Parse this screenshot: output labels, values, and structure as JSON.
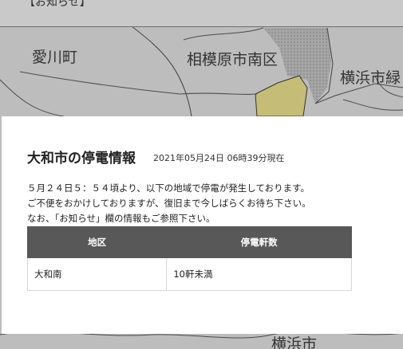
{
  "notice_bar": {
    "label": "【お知らせ】"
  },
  "map": {
    "labels": {
      "aikawa": "愛川町",
      "sagamihara": "相模原市南区",
      "yokohama": "横浜市緑",
      "bottom": "横浜市"
    },
    "colors": {
      "land": "#bdbdbd",
      "highlight": "#c5bd77",
      "dotted": "#9a9a9a",
      "road": "#4b4b4b"
    }
  },
  "panel": {
    "title": "大和市の停電情報",
    "timestamp": "2021年05月24日 06時39分現在",
    "messages": [
      "５月２４日５：５４頃より、以下の地域で停電が発生しております。",
      "ご不便をおかけしておりますが、復旧まで今しばらくお待ち下さい。",
      "なお、「お知らせ」欄の情報もご参照下さい。"
    ],
    "table": {
      "headers": [
        "地区",
        "停電軒数"
      ],
      "rows": [
        {
          "area": "大和南",
          "count": "10軒未満"
        }
      ]
    }
  }
}
